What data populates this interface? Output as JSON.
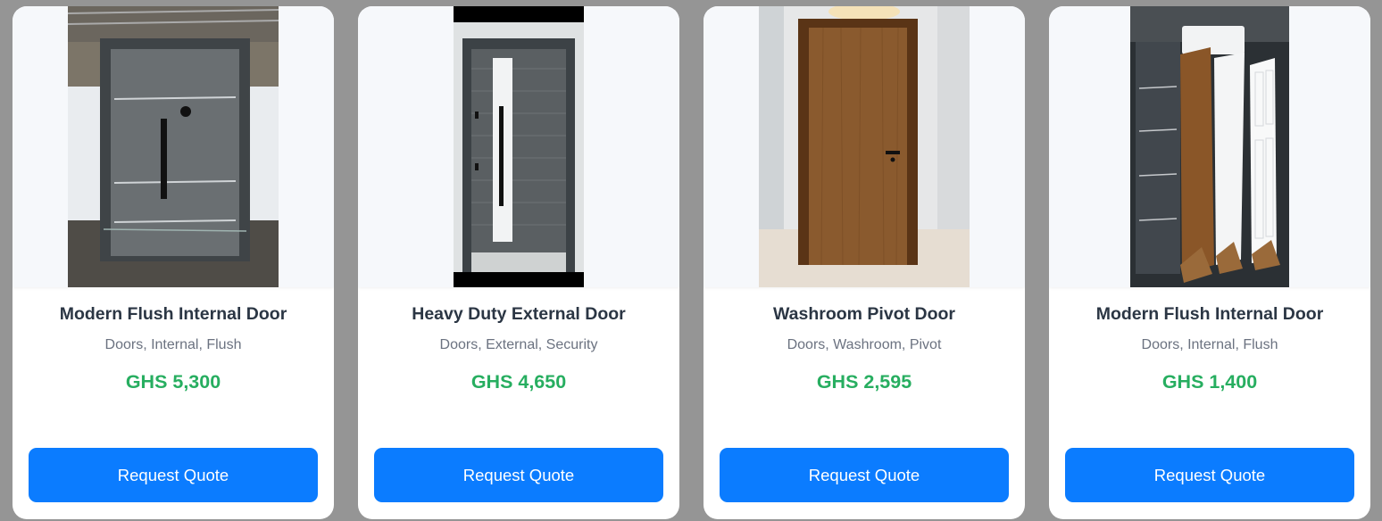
{
  "products": [
    {
      "title": "Modern Flush Internal Door",
      "tags": "Doors, Internal, Flush",
      "price": "GHS 5,300",
      "button": "Request Quote"
    },
    {
      "title": "Heavy Duty External Door",
      "tags": "Doors, External, Security",
      "price": "GHS 4,650",
      "button": "Request Quote"
    },
    {
      "title": "Washroom Pivot Door",
      "tags": "Doors, Washroom, Pivot",
      "price": "GHS 2,595",
      "button": "Request Quote"
    },
    {
      "title": "Modern Flush Internal Door",
      "tags": "Doors, Internal, Flush",
      "price": "GHS 1,400",
      "button": "Request Quote"
    }
  ],
  "colors": {
    "page_bg": "#959595",
    "button": "#0b7cff",
    "price": "#27ae60",
    "title": "#2b3644",
    "tags": "#6b7280"
  },
  "icons": [
    "product-image"
  ]
}
